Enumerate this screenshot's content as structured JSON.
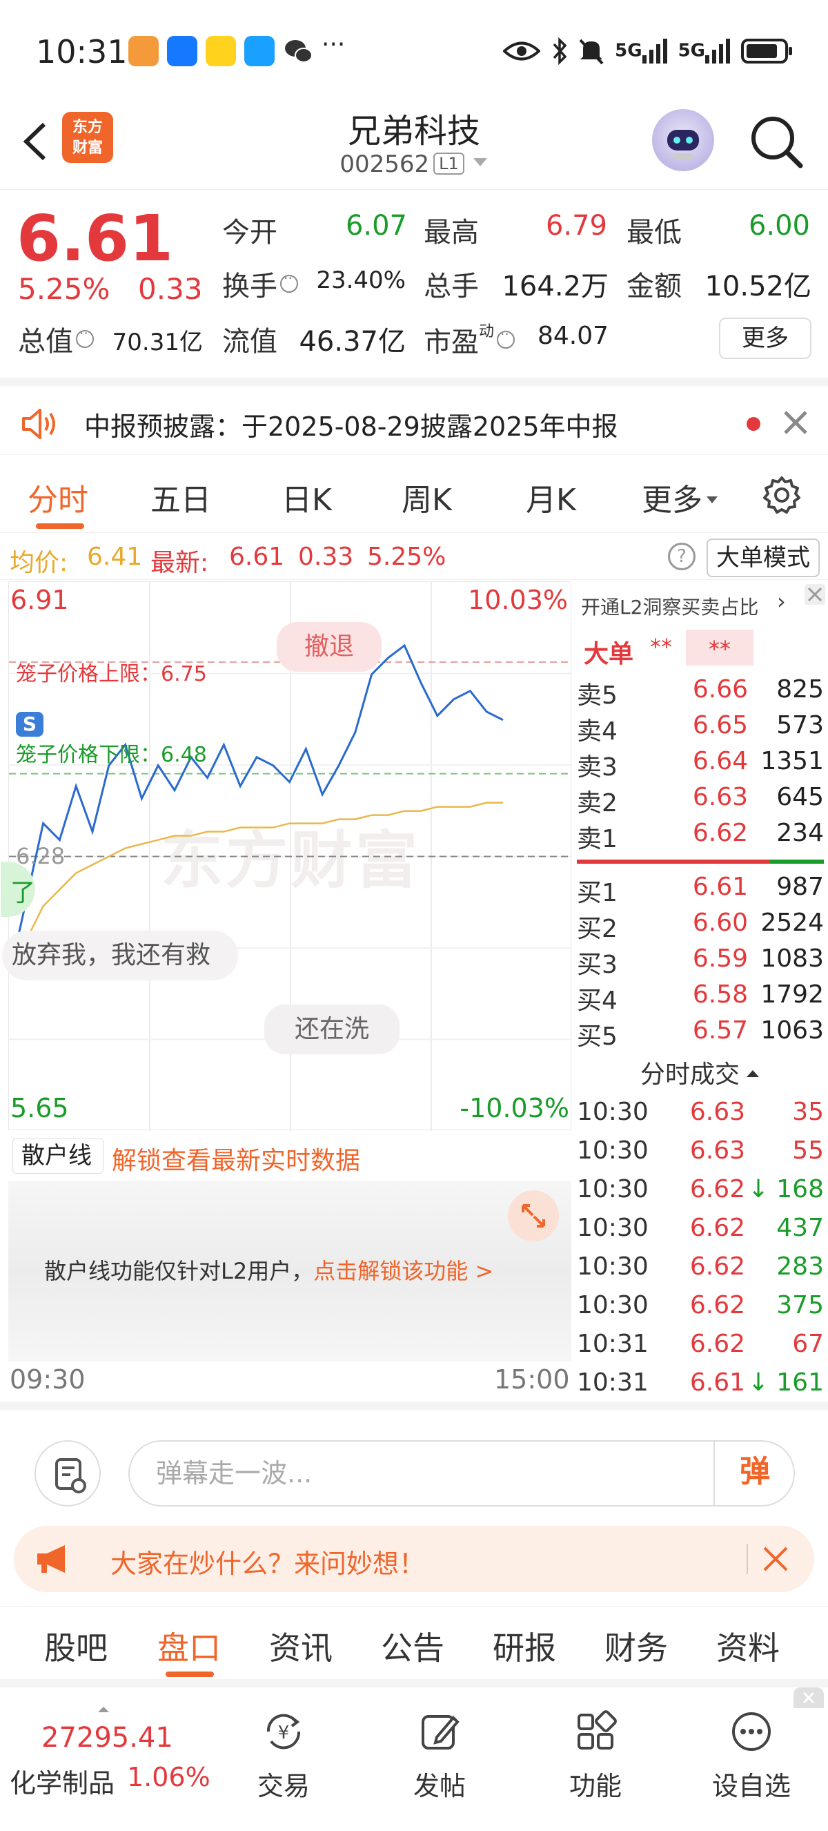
{
  "status_bar": {
    "time": "10:31",
    "more": "···",
    "signal1": "5G",
    "signal2": "5G"
  },
  "header": {
    "logo_line1": "东方",
    "logo_line2": "财富",
    "stock_name": "兄弟科技",
    "stock_code": "002562",
    "level_badge": "L1"
  },
  "quote": {
    "price": "6.61",
    "change_pct": "5.25%",
    "change": "0.33",
    "rows": [
      [
        {
          "label": "今开",
          "value": "6.07",
          "color": "green"
        },
        {
          "label": "最高",
          "value": "6.79",
          "color": "red"
        },
        {
          "label": "最低",
          "value": "6.00",
          "color": "green"
        }
      ],
      [
        {
          "label": "换手",
          "value": "23.40%",
          "color": "black",
          "info": true
        },
        {
          "label": "总手",
          "value": "164.2万",
          "color": "black"
        },
        {
          "label": "金额",
          "value": "10.52亿",
          "color": "black"
        }
      ],
      [
        {
          "label": "总值",
          "value": "70.31亿",
          "color": "black",
          "info": true
        },
        {
          "label": "流值",
          "value": "46.37亿",
          "color": "black"
        },
        {
          "label": "市盈",
          "value": "84.07",
          "color": "black",
          "info": true,
          "sup": "动"
        }
      ]
    ],
    "more_label": "更多"
  },
  "notice": {
    "text": "中报预披露：于2025-08-29披露2025年中报"
  },
  "chart_tabs": {
    "items": [
      "分时",
      "五日",
      "日K",
      "周K",
      "月K",
      "更多"
    ],
    "active": 0
  },
  "avg_row": {
    "avg_label": "均价:",
    "avg_value": "6.41",
    "latest_label": "最新:",
    "latest_value": "6.61",
    "latest_change": "0.33",
    "latest_pct": "5.25%",
    "help": "?",
    "big_order_mode": "大单模式"
  },
  "chart": {
    "top_price": "6.91",
    "top_pct": "10.03%",
    "bottom_price": "5.65",
    "bottom_pct": "-10.03%",
    "cage_up": "笼子价格上限：6.75",
    "cage_down": "笼子价格下限：6.48",
    "mid_price": "6.28",
    "s_badge": "S",
    "danmaku_1": "撤退",
    "danmaku_2": "放弃我，我还有救",
    "danmaku_3": "还在洗",
    "danmaku_4": "了",
    "watermark": "东方财富",
    "time_start": "09:30",
    "time_end": "15:00",
    "colors": {
      "price_line": "#2a6ad0",
      "avg_line": "#e8b84a",
      "cage_up": "#e4393c",
      "cage_down": "#1a9c2a"
    }
  },
  "chart_data": {
    "type": "line",
    "ylim": [
      5.65,
      6.91
    ],
    "prev_close": 6.28,
    "cage_upper": 6.75,
    "cage_lower": 6.48,
    "x": [
      "09:30",
      "09:31",
      "09:32",
      "09:33",
      "09:34",
      "09:35",
      "09:36",
      "09:37",
      "09:38",
      "09:39",
      "09:40",
      "09:41",
      "09:42",
      "09:43",
      "09:44",
      "09:45",
      "09:46",
      "09:47",
      "09:48",
      "09:49",
      "09:50",
      "09:51",
      "09:52",
      "09:53",
      "09:54",
      "09:55",
      "09:56",
      "09:57",
      "09:58",
      "09:59",
      "10:00"
    ],
    "series": [
      {
        "values": [
          6.0,
          6.18,
          6.36,
          6.32,
          6.45,
          6.34,
          6.5,
          6.55,
          6.42,
          6.5,
          6.44,
          6.52,
          6.47,
          6.55,
          6.45,
          6.52,
          6.5,
          6.46,
          6.54,
          6.43,
          6.5,
          6.58,
          6.72,
          6.76,
          6.79,
          6.7,
          6.62,
          6.66,
          6.68,
          6.63,
          6.61
        ]
      },
      {
        "values": [
          6.0,
          6.08,
          6.16,
          6.2,
          6.24,
          6.26,
          6.28,
          6.3,
          6.31,
          6.32,
          6.33,
          6.33,
          6.34,
          6.34,
          6.35,
          6.35,
          6.35,
          6.36,
          6.36,
          6.36,
          6.37,
          6.37,
          6.38,
          6.38,
          6.39,
          6.39,
          6.4,
          6.4,
          6.4,
          6.41,
          6.41
        ]
      }
    ]
  },
  "sanhu": {
    "select_label": "散户线",
    "unlock_link": "解锁查看最新实时数据",
    "panel_text": "散户线功能仅针对L2用户，",
    "panel_link": "点击解锁该功能 >"
  },
  "order_book": {
    "l2_text": "开通L2洞察买卖占比",
    "big_order_label": "大单",
    "big_order_v1": "**",
    "big_order_v2": "**",
    "asks": [
      {
        "label": "卖5",
        "price": "6.66",
        "vol": "825"
      },
      {
        "label": "卖4",
        "price": "6.65",
        "vol": "573"
      },
      {
        "label": "卖3",
        "price": "6.64",
        "vol": "1351"
      },
      {
        "label": "卖2",
        "price": "6.63",
        "vol": "645"
      },
      {
        "label": "卖1",
        "price": "6.62",
        "vol": "234"
      }
    ],
    "bids": [
      {
        "label": "买1",
        "price": "6.61",
        "vol": "987"
      },
      {
        "label": "买2",
        "price": "6.60",
        "vol": "2524"
      },
      {
        "label": "买3",
        "price": "6.59",
        "vol": "1083"
      },
      {
        "label": "买4",
        "price": "6.58",
        "vol": "1792"
      },
      {
        "label": "买5",
        "price": "6.57",
        "vol": "1063"
      }
    ],
    "tick_title": "分时成交",
    "ticks": [
      {
        "t": "10:30",
        "price": "6.63",
        "vol": "35",
        "side": "buy"
      },
      {
        "t": "10:30",
        "price": "6.63",
        "vol": "55",
        "side": "buy"
      },
      {
        "t": "10:30",
        "price": "6.62",
        "vol": "168",
        "side": "sell",
        "arrow": "↓"
      },
      {
        "t": "10:30",
        "price": "6.62",
        "vol": "437",
        "side": "sell"
      },
      {
        "t": "10:30",
        "price": "6.62",
        "vol": "283",
        "side": "sell"
      },
      {
        "t": "10:30",
        "price": "6.62",
        "vol": "375",
        "side": "sell"
      },
      {
        "t": "10:31",
        "price": "6.62",
        "vol": "67",
        "side": "buy"
      },
      {
        "t": "10:31",
        "price": "6.61",
        "vol": "161",
        "side": "sell",
        "arrow": "↓"
      }
    ]
  },
  "danmaku_input": {
    "placeholder": "弹幕走一波...",
    "send": "弹"
  },
  "ask_bar": {
    "text": "大家在炒什么？来问妙想！"
  },
  "bottom_tabs": {
    "items": [
      "股吧",
      "盘口",
      "资讯",
      "公告",
      "研报",
      "财务",
      "资料"
    ],
    "active": 1
  },
  "navbar": {
    "index_value": "27295.41",
    "index_name": "化学制品",
    "index_pct": "1.06%",
    "items": [
      "交易",
      "发帖",
      "功能",
      "设自选"
    ]
  }
}
